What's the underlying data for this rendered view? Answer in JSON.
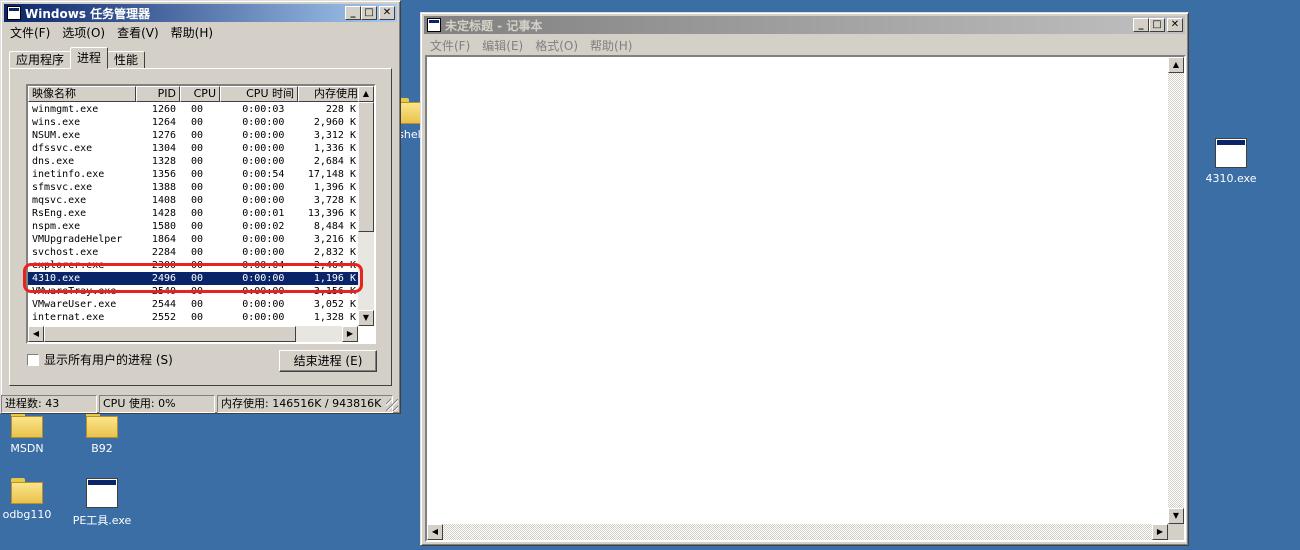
{
  "taskmgr": {
    "title": "Windows 任务管理器",
    "menu": [
      "文件(F)",
      "选项(O)",
      "查看(V)",
      "帮助(H)"
    ],
    "tabs": [
      "应用程序",
      "进程",
      "性能"
    ],
    "columns": [
      "映像名称",
      "PID",
      "CPU",
      "CPU 时间",
      "内存使用"
    ],
    "rows": [
      {
        "name": "winmgmt.exe",
        "pid": "1260",
        "cpu": "00",
        "time": "0:00:03",
        "mem": "228 K"
      },
      {
        "name": "wins.exe",
        "pid": "1264",
        "cpu": "00",
        "time": "0:00:00",
        "mem": "2,960 K"
      },
      {
        "name": "NSUM.exe",
        "pid": "1276",
        "cpu": "00",
        "time": "0:00:00",
        "mem": "3,312 K"
      },
      {
        "name": "dfssvc.exe",
        "pid": "1304",
        "cpu": "00",
        "time": "0:00:00",
        "mem": "1,336 K"
      },
      {
        "name": "dns.exe",
        "pid": "1328",
        "cpu": "00",
        "time": "0:00:00",
        "mem": "2,684 K"
      },
      {
        "name": "inetinfo.exe",
        "pid": "1356",
        "cpu": "00",
        "time": "0:00:54",
        "mem": "17,148 K"
      },
      {
        "name": "sfmsvc.exe",
        "pid": "1388",
        "cpu": "00",
        "time": "0:00:00",
        "mem": "1,396 K"
      },
      {
        "name": "mqsvc.exe",
        "pid": "1408",
        "cpu": "00",
        "time": "0:00:00",
        "mem": "3,728 K"
      },
      {
        "name": "RsEng.exe",
        "pid": "1428",
        "cpu": "00",
        "time": "0:00:01",
        "mem": "13,396 K"
      },
      {
        "name": "nspm.exe",
        "pid": "1580",
        "cpu": "00",
        "time": "0:00:02",
        "mem": "8,484 K"
      },
      {
        "name": "VMUpgradeHelper",
        "pid": "1864",
        "cpu": "00",
        "time": "0:00:00",
        "mem": "3,216 K"
      },
      {
        "name": "svchost.exe",
        "pid": "2284",
        "cpu": "00",
        "time": "0:00:00",
        "mem": "2,832 K"
      },
      {
        "name": "explorer.exe",
        "pid": "2300",
        "cpu": "00",
        "time": "0:00:04",
        "mem": "2,464 K"
      },
      {
        "name": "4310.exe",
        "pid": "2496",
        "cpu": "00",
        "time": "0:00:00",
        "mem": "1,196 K",
        "selected": true
      },
      {
        "name": "VMwareTray.exe",
        "pid": "2540",
        "cpu": "00",
        "time": "0:00:00",
        "mem": "3,156 K"
      },
      {
        "name": "VMwareUser.exe",
        "pid": "2544",
        "cpu": "00",
        "time": "0:00:00",
        "mem": "3,052 K"
      },
      {
        "name": "internat.exe",
        "pid": "2552",
        "cpu": "00",
        "time": "0:00:00",
        "mem": "1,328 K"
      }
    ],
    "show_all_users": "显示所有用户的进程 (S)",
    "end_process": "结束进程 (E)",
    "status": {
      "processes": "进程数: 43",
      "cpu": "CPU 使用: 0%",
      "memory": "内存使用: 146516K / 943816K"
    }
  },
  "notepad": {
    "title": "未定标题 - 记事本",
    "menu": [
      "文件(F)",
      "编辑(E)",
      "格式(O)",
      "帮助(H)"
    ]
  },
  "desktop": {
    "icons": [
      {
        "label": "shell"
      },
      {
        "label": "4310.exe"
      },
      {
        "label": "MSDN"
      },
      {
        "label": "B92"
      },
      {
        "label": "odbg110"
      },
      {
        "label": "PE工具.exe"
      }
    ]
  },
  "colors": {
    "desktop": "#3a6ea5",
    "title_active": "#0a246a",
    "selection": "#0a246a",
    "highlight_ring": "#e8221c"
  }
}
